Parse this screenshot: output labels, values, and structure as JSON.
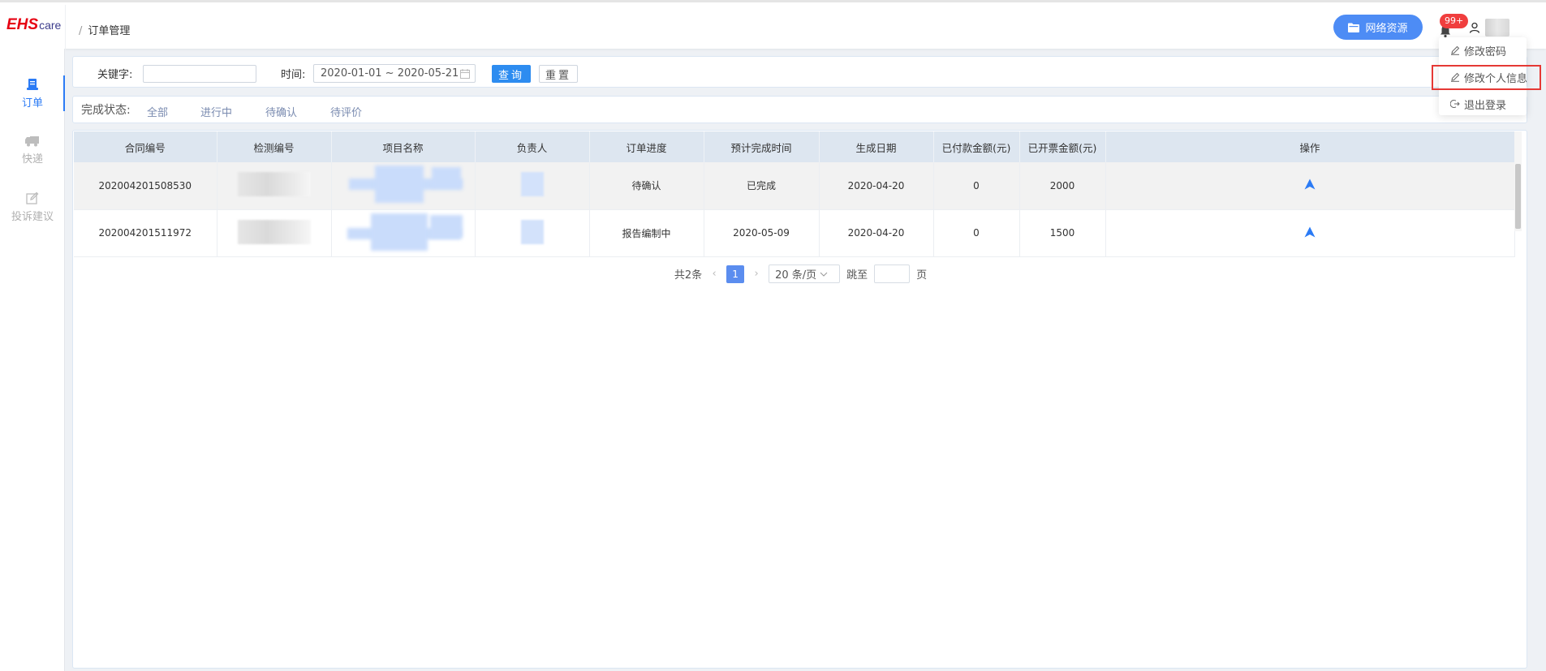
{
  "brand": {
    "ehs": "EHS",
    "care": "care"
  },
  "breadcrumb": {
    "separator": "/",
    "current": "订单管理"
  },
  "header": {
    "network_button": "网络资源",
    "badge": "99+"
  },
  "user_menu": {
    "items": [
      {
        "label": "修改密码",
        "icon": "edit-icon"
      },
      {
        "label": "修改个人信息",
        "icon": "edit-icon"
      },
      {
        "label": "退出登录",
        "icon": "logout-icon"
      }
    ],
    "highlighted_index": 1
  },
  "sidebar": {
    "items": [
      {
        "label": "订单",
        "icon": "order-icon",
        "active": true
      },
      {
        "label": "快递",
        "icon": "truck-icon",
        "active": false
      },
      {
        "label": "投诉建议",
        "icon": "edit-icon",
        "active": false
      }
    ]
  },
  "filter": {
    "keyword_label": "关键字:",
    "keyword_value": "",
    "time_label": "时间:",
    "date_range": "2020-01-01 ~ 2020-05-21",
    "query_button": "查询",
    "reset_button": "重置"
  },
  "status": {
    "label": "完成状态:",
    "tabs": [
      "全部",
      "进行中",
      "待确认",
      "待评价"
    ]
  },
  "table": {
    "headers": [
      "合同编号",
      "检测编号",
      "项目名称",
      "负责人",
      "订单进度",
      "预计完成时间",
      "生成日期",
      "已付款金额(元)",
      "已开票金额(元)",
      "操作"
    ],
    "rows": [
      {
        "contract_no": "202004201508530",
        "progress": "待确认",
        "expected": "已完成",
        "created": "2020-04-20",
        "paid": "0",
        "invoiced": "2000",
        "action_icon": "navigate-icon"
      },
      {
        "contract_no": "202004201511972",
        "progress": "报告编制中",
        "expected": "2020-05-09",
        "created": "2020-04-20",
        "paid": "0",
        "invoiced": "1500",
        "action_icon": "navigate-icon"
      }
    ]
  },
  "pagination": {
    "total": "共2条",
    "current_page": "1",
    "page_size": "20 条/页",
    "jump_label": "跳至",
    "page_unit": "页"
  }
}
